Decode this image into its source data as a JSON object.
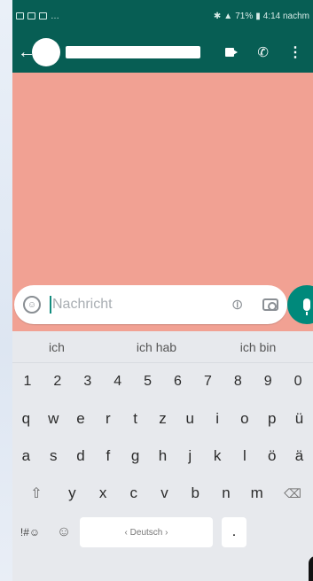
{
  "statusbar": {
    "signal_text": "71%",
    "time_text": "4:14 nachm"
  },
  "appbar": {
    "back_icon": "arrow-left-icon",
    "actions": [
      "video-call-icon",
      "phone-icon",
      "more-vert-icon"
    ]
  },
  "composer": {
    "placeholder": "Nachricht",
    "emoji_icon": "emoji-icon",
    "attach_icon": "paperclip-icon",
    "camera_icon": "camera-icon",
    "send_icon": "mic-icon"
  },
  "keyboard": {
    "suggestions": [
      "ich",
      "ich hab",
      "ich bin"
    ],
    "numbers": [
      "1",
      "2",
      "3",
      "4",
      "5",
      "6",
      "7",
      "8",
      "9",
      "0"
    ],
    "row_qwertz": [
      "q",
      "w",
      "e",
      "r",
      "t",
      "z",
      "u",
      "i",
      "o",
      "p",
      "ü"
    ],
    "row_asdf": [
      "a",
      "s",
      "d",
      "f",
      "g",
      "h",
      "j",
      "k",
      "l",
      "ö",
      "ä"
    ],
    "row_yxcv": [
      "y",
      "x",
      "c",
      "v",
      "b",
      "n",
      "m"
    ],
    "symbols_label": "!#☺",
    "space_label": "‹ Deutsch ›",
    "period_label": "."
  },
  "colors": {
    "header_teal": "#075e54",
    "chat_background": "#f1a193",
    "mic_button": "#00897b"
  }
}
